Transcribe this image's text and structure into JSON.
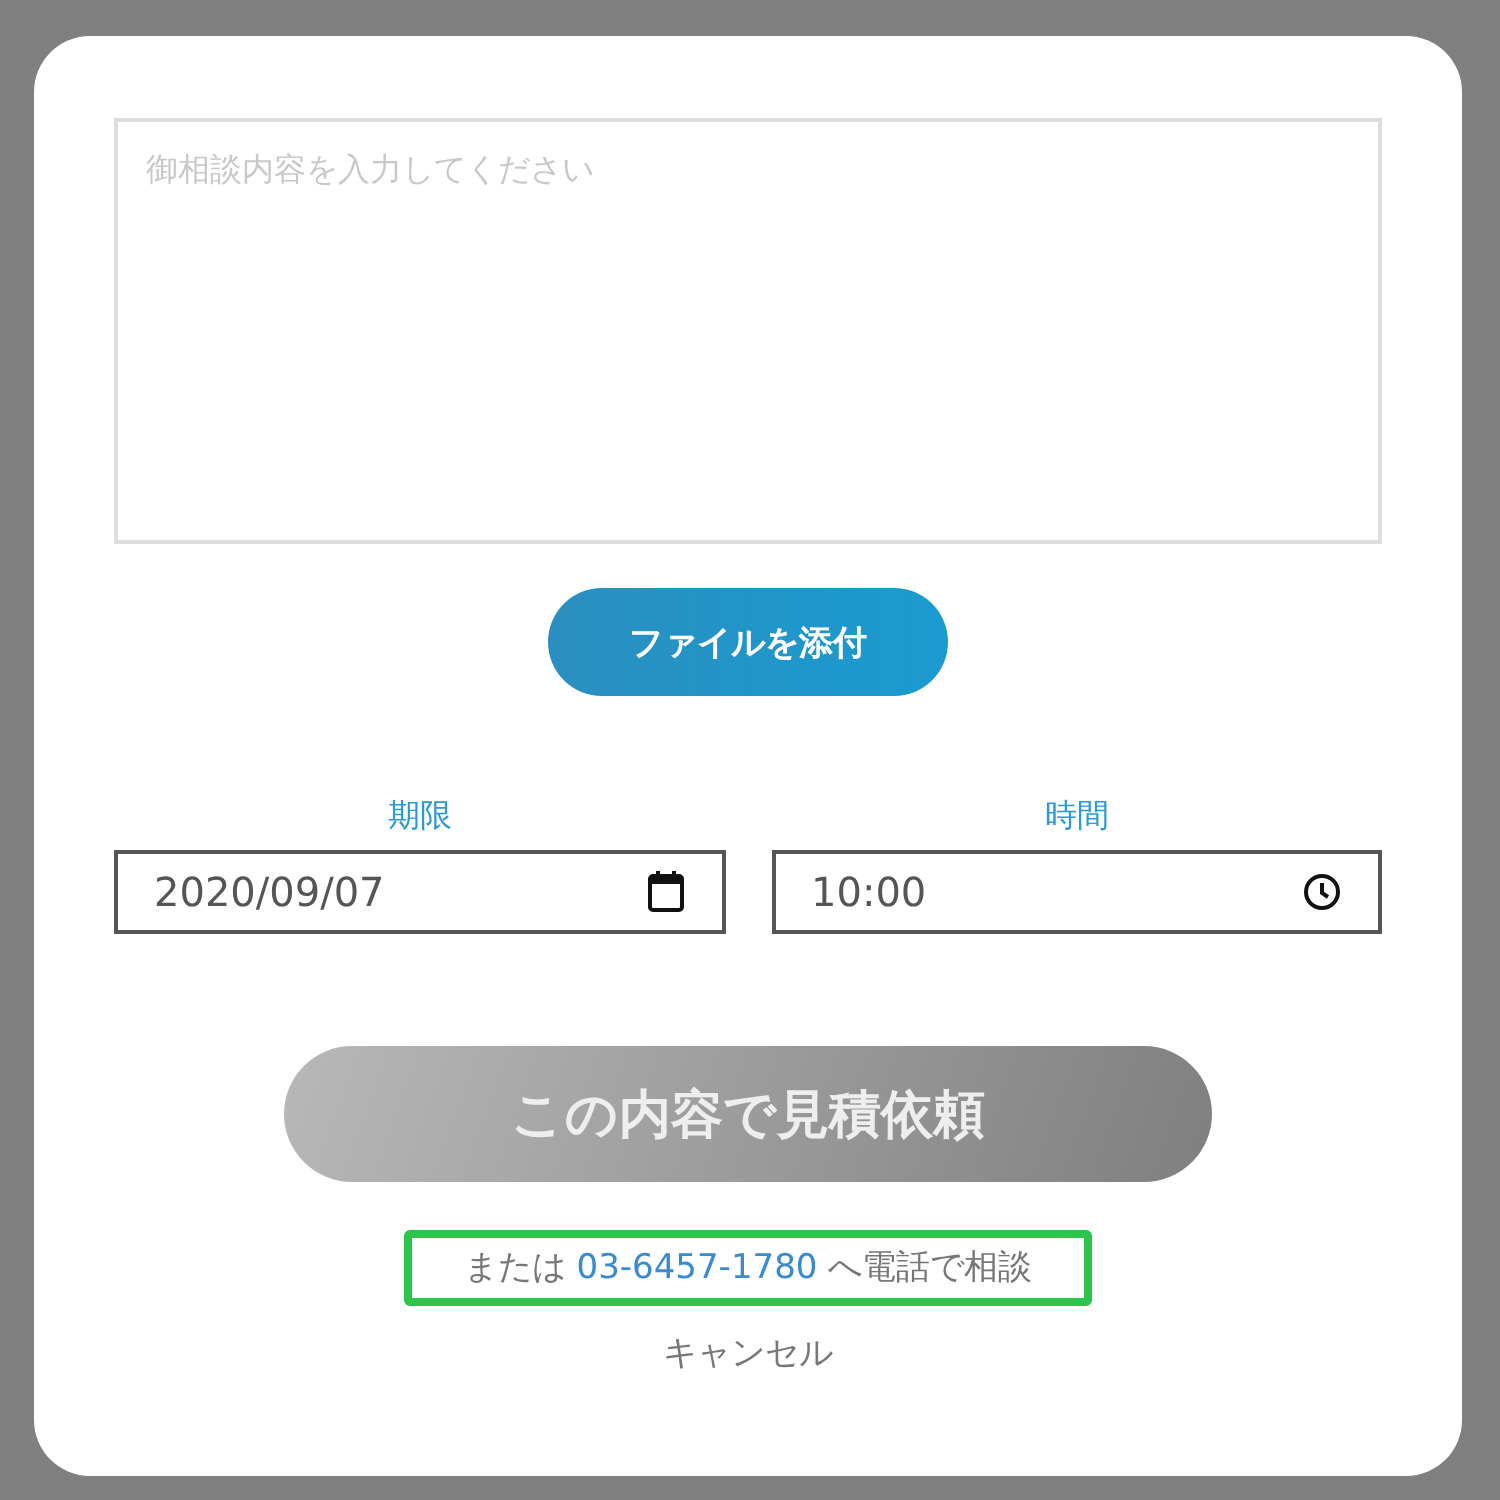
{
  "message": {
    "placeholder": "御相談内容を入力してください"
  },
  "attach_button": {
    "label": "ファイルを添付"
  },
  "fields": [
    {
      "kind": "date",
      "label": "期限",
      "value": "2020/09/07"
    },
    {
      "kind": "time",
      "label": "時間",
      "value": "10:00"
    }
  ],
  "submit": {
    "label": "この内容で見積依頼",
    "disabled": true
  },
  "phone_note": {
    "prefix": "または",
    "phone": "03-6457-1780",
    "suffix": "へ電話で相談",
    "highlighted": true
  },
  "cancel": {
    "label": "キャンセル"
  }
}
